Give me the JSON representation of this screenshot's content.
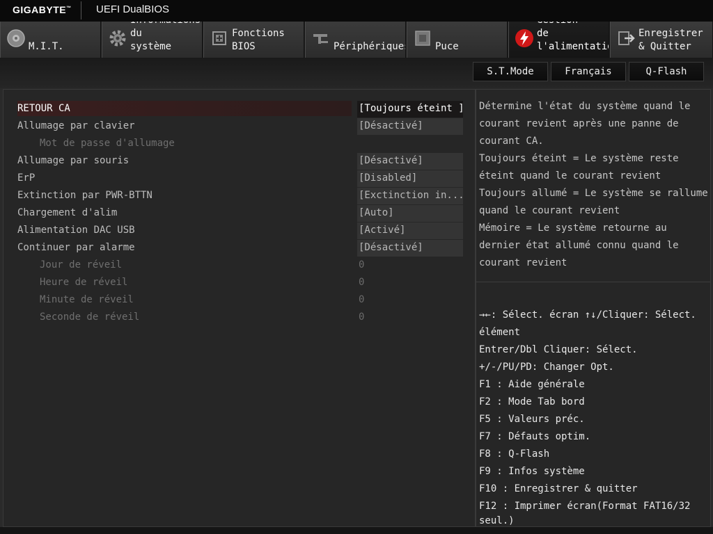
{
  "header": {
    "brand": "GIGABYTE",
    "brand_tm": "™",
    "product": "UEFI DualBIOS"
  },
  "tabs": [
    {
      "id": "mit",
      "line1": "",
      "line2": "M.I.T.",
      "icon": "gauge-icon",
      "active": false
    },
    {
      "id": "info",
      "line0": "Informations",
      "line1": "du",
      "line2": "système",
      "icon": "gear-icon",
      "active": false
    },
    {
      "id": "bios",
      "line1": "Fonctions",
      "line2": "BIOS",
      "icon": "bios-chip-icon",
      "active": false
    },
    {
      "id": "periph",
      "line1": "",
      "line2": "Périphériques",
      "icon": "plug-icon",
      "active": false
    },
    {
      "id": "chip",
      "line1": "",
      "line2": "Puce",
      "icon": "chipset-icon",
      "active": false
    },
    {
      "id": "power",
      "line0": "Gestion",
      "line1": "de",
      "line2": "l'alimentatio",
      "icon": "power-bolt-icon",
      "active": true
    },
    {
      "id": "save",
      "line1": "Enregistrer",
      "line2": "& Quitter",
      "icon": "exit-icon",
      "active": false
    }
  ],
  "quick_buttons": {
    "stmode": "S.T.Mode",
    "lang": "Français",
    "qflash": "Q-Flash"
  },
  "settings": [
    {
      "name": "RETOUR CA",
      "value": "[Toujours éteint ]"
    },
    {
      "name": "Allumage par clavier",
      "value": "[Désactivé]"
    },
    {
      "name": "Mot de passe d'allumage",
      "value": ""
    },
    {
      "name": "Allumage par souris",
      "value": "[Désactivé]"
    },
    {
      "name": "ErP",
      "value": "[Disabled]"
    },
    {
      "name": "Extinction par PWR-BTTN",
      "value": "[Exctinction in...]"
    },
    {
      "name": "Chargement d'alim",
      "value": "[Auto]"
    },
    {
      "name": "Alimentation DAC USB",
      "value": "[Activé]"
    },
    {
      "name": "Continuer par alarme",
      "value": "[Désactivé]"
    },
    {
      "name": "Jour de réveil",
      "value": "0"
    },
    {
      "name": "Heure de réveil",
      "value": "0"
    },
    {
      "name": "Minute de réveil",
      "value": "0"
    },
    {
      "name": "Seconde de réveil",
      "value": "0"
    }
  ],
  "help_text": [
    "Détermine l'état du système quand le",
    "courant revient après une panne de",
    "courant CA.",
    "Toujours éteint = Le système reste",
    "éteint quand le courant revient",
    "Toujours allumé = Le système se rallume",
    "quand le courant revient",
    "Mémoire = Le système retourne au",
    "dernier état allumé connu quand le",
    "courant revient"
  ],
  "key_help": [
    "→←: Sélect. écran  ↑↓/Cliquer: Sélect.",
    "élément",
    "Entrer/Dbl Cliquer: Sélect.",
    "+/-/PU/PD: Changer Opt.",
    "F1  : Aide générale",
    "F2  : Mode Tab bord",
    "F5  : Valeurs préc.",
    "F7  : Défauts optim.",
    "F8  : Q-Flash",
    "F9  : Infos système",
    "F10 : Enregistrer & quitter",
    "F12 : Imprimer écran(Format FAT16/32",
    "seul.)"
  ],
  "colors": {
    "accent_red": "#d01818",
    "selected_row": "#3a1e1e"
  }
}
